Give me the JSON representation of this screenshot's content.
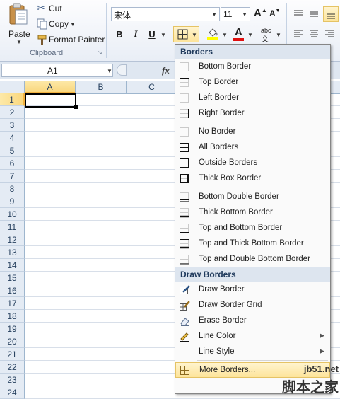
{
  "clipboard": {
    "paste_label": "Paste",
    "cut_label": "Cut",
    "copy_label": "Copy",
    "format_painter_label": "Format Painter",
    "group_label": "Clipboard"
  },
  "font": {
    "name": "宋体",
    "size": "11",
    "grow_label": "A",
    "shrink_label": "A",
    "bold": "B",
    "italic": "I",
    "underline": "U",
    "font_color_letter": "A",
    "abc_label": "abc"
  },
  "formula_bar": {
    "name_box": "A1",
    "fx": "fx"
  },
  "grid": {
    "columns": [
      "A",
      "B",
      "C"
    ],
    "rows": [
      "1",
      "2",
      "3",
      "4",
      "5",
      "6",
      "7",
      "8",
      "9",
      "10",
      "11",
      "12",
      "13",
      "14",
      "15",
      "16",
      "17",
      "18",
      "19",
      "20",
      "21",
      "22",
      "23",
      "24"
    ],
    "selected_cell": "A1"
  },
  "menu": {
    "header_borders": "Borders",
    "header_draw": "Draw Borders",
    "items": [
      {
        "label": "Bottom Border",
        "icon": "bottom-border-icon"
      },
      {
        "label": "Top Border",
        "icon": "top-border-icon"
      },
      {
        "label": "Left Border",
        "icon": "left-border-icon"
      },
      {
        "label": "Right Border",
        "icon": "right-border-icon"
      },
      {
        "label": "No Border",
        "icon": "no-border-icon"
      },
      {
        "label": "All Borders",
        "icon": "all-borders-icon"
      },
      {
        "label": "Outside Borders",
        "icon": "outside-borders-icon"
      },
      {
        "label": "Thick Box Border",
        "icon": "thick-box-border-icon"
      },
      {
        "label": "Bottom Double Border",
        "icon": "bottom-double-border-icon"
      },
      {
        "label": "Thick Bottom Border",
        "icon": "thick-bottom-border-icon"
      },
      {
        "label": "Top and Bottom Border",
        "icon": "top-bottom-border-icon"
      },
      {
        "label": "Top and Thick Bottom Border",
        "icon": "top-thick-bottom-border-icon"
      },
      {
        "label": "Top and Double Bottom Border",
        "icon": "top-double-bottom-border-icon"
      }
    ],
    "draw_items": [
      {
        "label": "Draw Border",
        "icon": "draw-border-icon"
      },
      {
        "label": "Draw Border Grid",
        "icon": "draw-border-grid-icon"
      },
      {
        "label": "Erase Border",
        "icon": "eraser-icon"
      },
      {
        "label": "Line Color",
        "icon": "pencil-icon"
      },
      {
        "label": "Line Style",
        "icon": "line-style-icon"
      },
      {
        "label": "More Borders...",
        "icon": "more-borders-icon"
      }
    ]
  },
  "watermark": {
    "line1": "jb51.net",
    "line2": "脚本之家"
  },
  "colors": {
    "accent_highlight": "#fde49a",
    "selected_header": "#f9d77e",
    "menu_header_bg": "#dde5ef",
    "font_color_red": "#e01010",
    "fill_color_yellow": "#ffff00"
  }
}
